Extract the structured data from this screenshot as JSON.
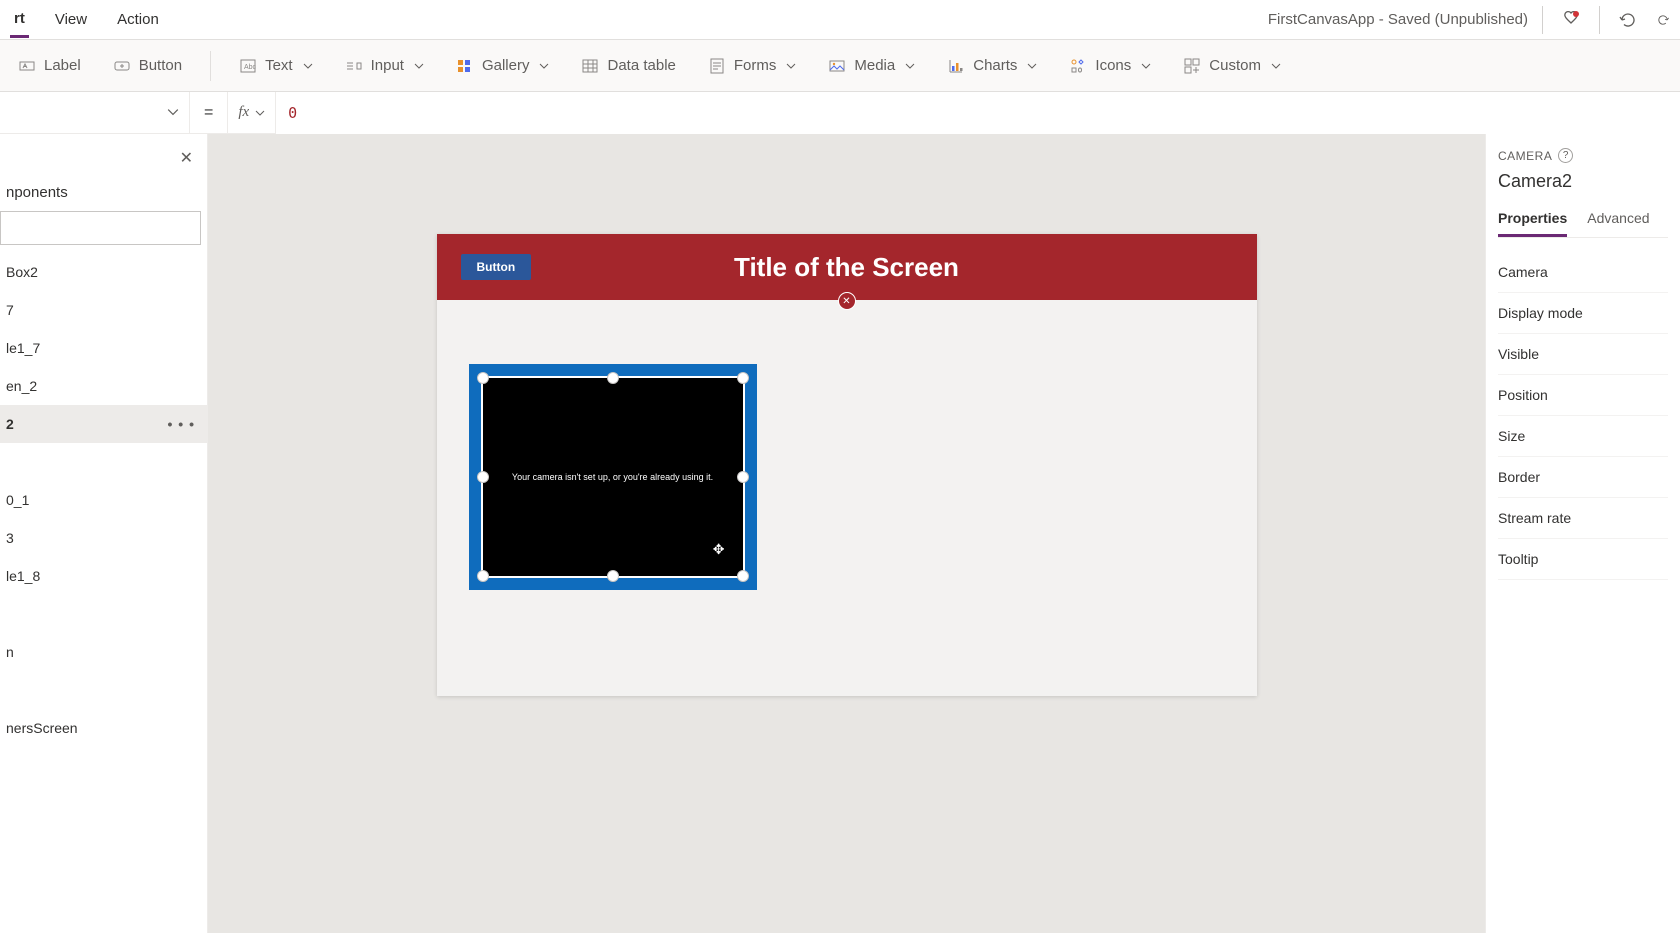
{
  "menu": {
    "items": [
      "rt",
      "View",
      "Action"
    ],
    "active_index": 0
  },
  "app_title": "FirstCanvasApp - Saved (Unpublished)",
  "ribbon": {
    "label": "Label",
    "button": "Button",
    "text": "Text",
    "input": "Input",
    "gallery": "Gallery",
    "datatable": "Data table",
    "forms": "Forms",
    "media": "Media",
    "charts": "Charts",
    "icons": "Icons",
    "custom": "Custom"
  },
  "formula": {
    "equals": "=",
    "fx": "fx",
    "value": "0"
  },
  "tree": {
    "header": "nponents",
    "search_placeholder": "",
    "items": [
      "Box2",
      "7",
      "le1_7",
      "en_2",
      "2",
      "",
      "0_1",
      "3",
      "le1_8",
      "",
      "n",
      "",
      "nersScreen"
    ],
    "selected_index": 4
  },
  "canvas": {
    "screen_title": "Title of the Screen",
    "button_label": "Button",
    "camera_message": "Your camera isn't set up, or you're already using it."
  },
  "properties": {
    "type_label": "CAMERA",
    "control_name": "Camera2",
    "tabs": [
      "Properties",
      "Advanced"
    ],
    "active_tab": 0,
    "rows": [
      "Camera",
      "Display mode",
      "Visible",
      "Position",
      "Size",
      "Border",
      "Stream rate",
      "Tooltip"
    ]
  }
}
